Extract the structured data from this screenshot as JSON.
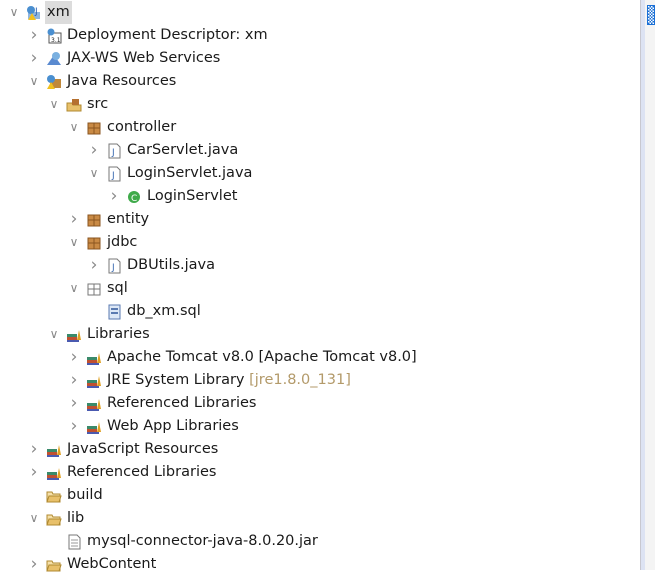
{
  "tree": [
    {
      "label": "xm",
      "level": 0,
      "state": "expanded",
      "icon": "web-project-icon",
      "selected": true
    },
    {
      "label": "Deployment Descriptor: xm",
      "level": 1,
      "state": "collapsed",
      "icon": "deployment-descriptor-icon"
    },
    {
      "label": "JAX-WS Web Services",
      "level": 1,
      "state": "collapsed",
      "icon": "web-services-icon"
    },
    {
      "label": "Java Resources",
      "level": 1,
      "state": "expanded",
      "icon": "java-resources-icon"
    },
    {
      "label": "src",
      "level": 2,
      "state": "expanded",
      "icon": "source-folder-icon"
    },
    {
      "label": "controller",
      "level": 3,
      "state": "expanded",
      "icon": "package-icon"
    },
    {
      "label": "CarServlet.java",
      "level": 4,
      "state": "collapsed",
      "icon": "java-file-icon"
    },
    {
      "label": "LoginServlet.java",
      "level": 4,
      "state": "expanded",
      "icon": "java-file-icon"
    },
    {
      "label": "LoginServlet",
      "level": 5,
      "state": "collapsed",
      "icon": "class-icon"
    },
    {
      "label": "entity",
      "level": 3,
      "state": "collapsed",
      "icon": "package-icon"
    },
    {
      "label": "jdbc",
      "level": 3,
      "state": "expanded",
      "icon": "package-icon"
    },
    {
      "label": "DBUtils.java",
      "level": 4,
      "state": "collapsed",
      "icon": "java-file-icon"
    },
    {
      "label": "sql",
      "level": 3,
      "state": "expanded",
      "icon": "empty-package-icon"
    },
    {
      "label": "db_xm.sql",
      "level": 4,
      "state": "leaf",
      "icon": "sql-file-icon"
    },
    {
      "label": "Libraries",
      "level": 2,
      "state": "expanded",
      "icon": "library-icon"
    },
    {
      "label": "Apache Tomcat v8.0 [Apache Tomcat v8.0]",
      "level": 3,
      "state": "collapsed",
      "icon": "library-icon"
    },
    {
      "label": "JRE System Library",
      "decoration": "[jre1.8.0_131]",
      "level": 3,
      "state": "collapsed",
      "icon": "library-icon"
    },
    {
      "label": "Referenced Libraries",
      "level": 3,
      "state": "collapsed",
      "icon": "library-icon"
    },
    {
      "label": "Web App Libraries",
      "level": 3,
      "state": "collapsed",
      "icon": "library-icon"
    },
    {
      "label": "JavaScript Resources",
      "level": 1,
      "state": "collapsed",
      "icon": "library-icon"
    },
    {
      "label": "Referenced Libraries",
      "level": 1,
      "state": "collapsed",
      "icon": "library-icon"
    },
    {
      "label": "build",
      "level": 1,
      "state": "leaf",
      "icon": "folder-icon"
    },
    {
      "label": "lib",
      "level": 1,
      "state": "expanded",
      "icon": "folder-icon"
    },
    {
      "label": "mysql-connector-java-8.0.20.jar",
      "level": 2,
      "state": "leaf",
      "icon": "file-icon"
    },
    {
      "label": "WebContent",
      "level": 1,
      "state": "collapsed",
      "icon": "folder-icon"
    }
  ],
  "colors": {
    "selection": "#dcdcdc",
    "decoration": "#b39a6a",
    "folder": "#e8c06a",
    "package": "#b5702f"
  }
}
